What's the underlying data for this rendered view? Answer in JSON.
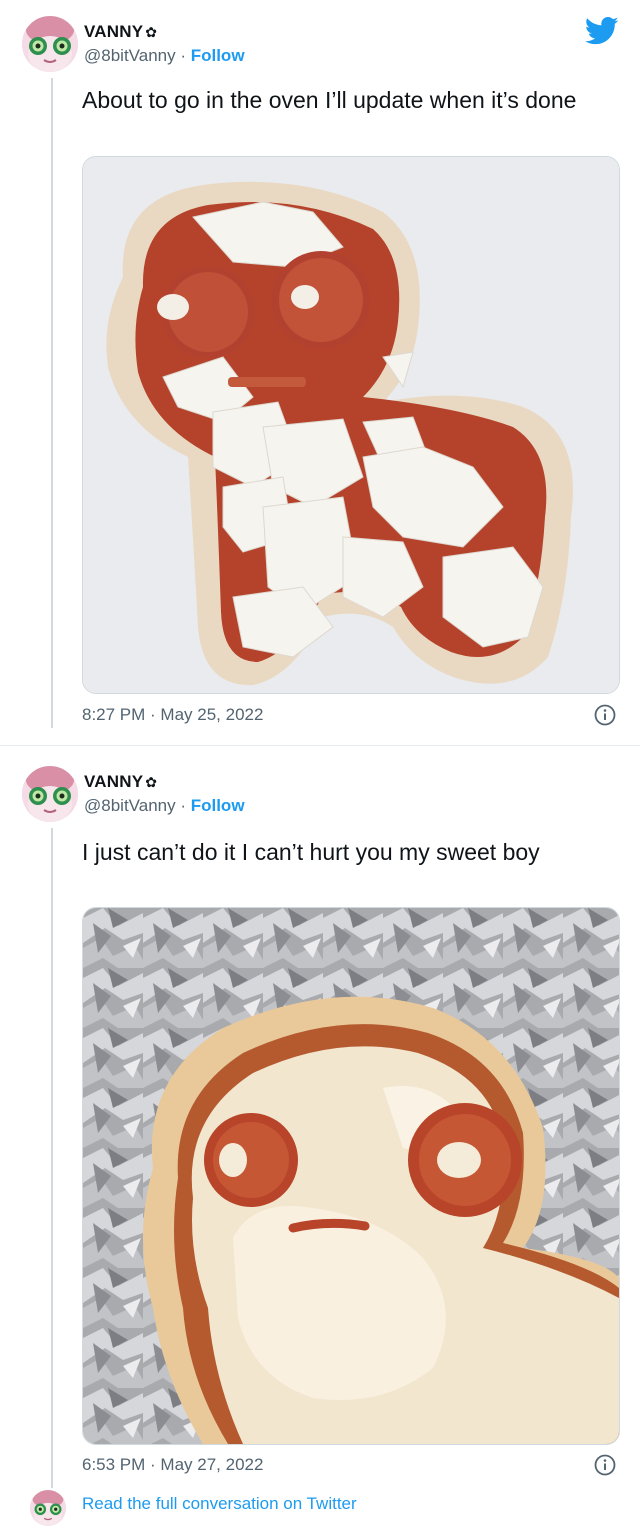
{
  "tweets": [
    {
      "display_name": "VANNY",
      "name_glyph": "✿",
      "handle": "@8bitVanny",
      "separator": " · ",
      "follow_label": "Follow",
      "text": "About to go in the oven I’ll update when it’s done",
      "time": "8:27 PM · May 25, 2022",
      "media_description": "raw pizza dough shaped like a small figure, topped with sauce, mozzarella and two pepperoni eyes"
    },
    {
      "display_name": "VANNY",
      "name_glyph": "✿",
      "handle": "@8bitVanny",
      "separator": " · ",
      "follow_label": "Follow",
      "text": "I just can’t do it I can’t hurt you my sweet boy",
      "time": "6:53 PM · May 27, 2022",
      "media_description": "baked pizza figure with melted cheese and pepperoni eyes on crumpled aluminum foil"
    }
  ],
  "footer": {
    "link_text": "Read the full conversation on Twitter"
  },
  "icons": {
    "brand": "twitter-bird-icon",
    "info": "info-icon"
  },
  "colors": {
    "accent": "#1d9bf0",
    "secondary_text": "#536471",
    "primary_text": "#0f1419"
  }
}
